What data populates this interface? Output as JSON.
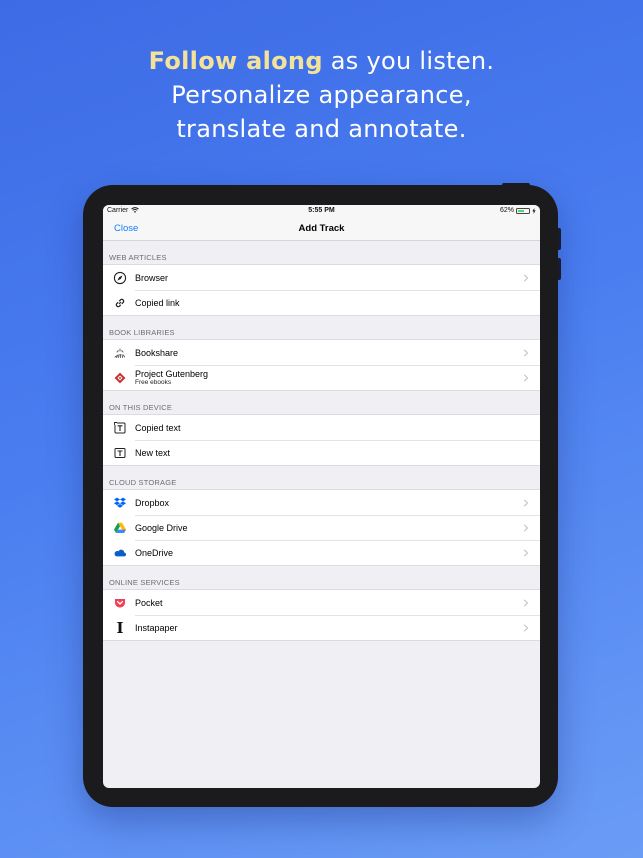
{
  "headline": {
    "highlight": "Follow along",
    "line1_rest": " as you listen.",
    "line2": "Personalize  appearance,",
    "line3": "translate and annotate."
  },
  "status_bar": {
    "carrier": "Carrier",
    "time": "5:55 PM",
    "battery_text": "62%",
    "battery_level": 0.62
  },
  "nav": {
    "close_label": "Close",
    "title": "Add Track"
  },
  "sections": [
    {
      "header": "WEB ARTICLES",
      "items": [
        {
          "label": "Browser",
          "icon": "compass-icon",
          "chevron": true
        },
        {
          "label": "Copied link",
          "icon": "link-icon",
          "chevron": false
        }
      ]
    },
    {
      "header": "BOOK LIBRARIES",
      "items": [
        {
          "label": "Bookshare",
          "icon": "bookshare-icon",
          "chevron": true
        },
        {
          "label": "Project Gutenberg",
          "sub": "Free ebooks",
          "icon": "gutenberg-icon",
          "chevron": true
        }
      ]
    },
    {
      "header": "ON THIS DEVICE",
      "items": [
        {
          "label": "Copied text",
          "icon": "copied-text-icon",
          "chevron": false
        },
        {
          "label": "New text",
          "icon": "new-text-icon",
          "chevron": false
        }
      ]
    },
    {
      "header": "CLOUD STORAGE",
      "items": [
        {
          "label": "Dropbox",
          "icon": "dropbox-icon",
          "chevron": true
        },
        {
          "label": "Google Drive",
          "icon": "google-drive-icon",
          "chevron": true
        },
        {
          "label": "OneDrive",
          "icon": "onedrive-icon",
          "chevron": true
        }
      ]
    },
    {
      "header": "ONLINE SERVICES",
      "items": [
        {
          "label": "Pocket",
          "icon": "pocket-icon",
          "chevron": true
        },
        {
          "label": "Instapaper",
          "icon": "instapaper-icon",
          "chevron": true
        }
      ]
    }
  ],
  "colors": {
    "accent": "#147efb",
    "highlight": "#f3e39a",
    "background_top": "#3d6be6",
    "background_bottom": "#6a9cf6",
    "pocket": "#ef4056",
    "dropbox": "#0061fe",
    "gutenberg": "#c4302b"
  }
}
